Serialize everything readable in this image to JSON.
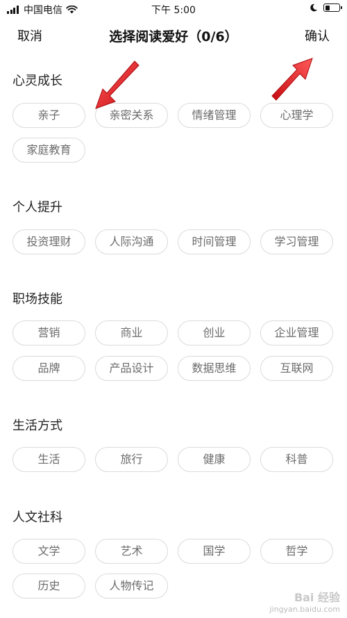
{
  "status_bar": {
    "carrier": "中国电信",
    "time": "下午 5:00",
    "battery_level": 0.35
  },
  "nav": {
    "cancel_label": "取消",
    "title": "选择阅读爱好（0/6）",
    "confirm_label": "确认"
  },
  "sections": [
    {
      "title": "心灵成长",
      "tags": [
        "亲子",
        "亲密关系",
        "情绪管理",
        "心理学",
        "家庭教育"
      ]
    },
    {
      "title": "个人提升",
      "tags": [
        "投资理财",
        "人际沟通",
        "时间管理",
        "学习管理"
      ]
    },
    {
      "title": "职场技能",
      "tags": [
        "营销",
        "商业",
        "创业",
        "企业管理",
        "品牌",
        "产品设计",
        "数据思维",
        "互联网"
      ]
    },
    {
      "title": "生活方式",
      "tags": [
        "生活",
        "旅行",
        "健康",
        "科普"
      ]
    },
    {
      "title": "人文社科",
      "tags": [
        "文学",
        "艺术",
        "国学",
        "哲学",
        "历史",
        "人物传记"
      ]
    }
  ],
  "watermark": {
    "line1": "Bai 经验",
    "line2": "jingyan.baidu.com"
  },
  "colors": {
    "arrow": "#e8141b",
    "tag_border": "#dadada",
    "tag_text": "#6b6b6b"
  }
}
